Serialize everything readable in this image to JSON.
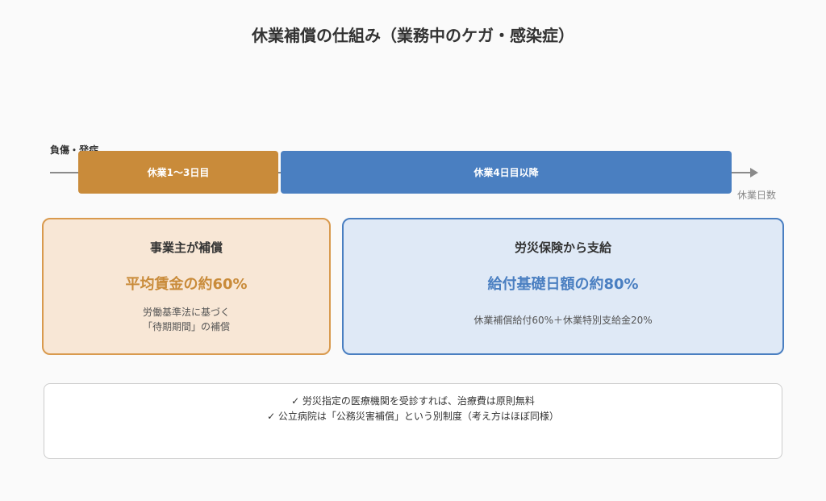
{
  "title": "休業補償の仕組み（業務中のケガ・感染症）",
  "timeline": {
    "start_label": "負傷・発症",
    "axis_label": "休業日数",
    "segments": [
      {
        "label": "休業1〜3日目"
      },
      {
        "label": "休業4日目以降"
      }
    ]
  },
  "cards": [
    {
      "title": "事業主が補償",
      "value": "平均賃金の約60%",
      "note_lines": [
        "労働基準法に基づく",
        "「待期期間」の補償"
      ]
    },
    {
      "title": "労災保険から支給",
      "value": "給付基礎日額の約80%",
      "note_lines": [
        "休業補償給付60%＋休業特別支給金20%"
      ]
    }
  ],
  "notes": [
    "✓ 労災指定の医療機関を受診すれば、治療費は原則無料",
    "✓ 公立病院は「公務災害補償」という別制度（考え方はほぼ同様）"
  ],
  "colors": {
    "employer": "#c98b3a",
    "insurance": "#4a7fc1",
    "employer_bg": "#f8e7d6",
    "insurance_bg": "#dfe9f6"
  }
}
